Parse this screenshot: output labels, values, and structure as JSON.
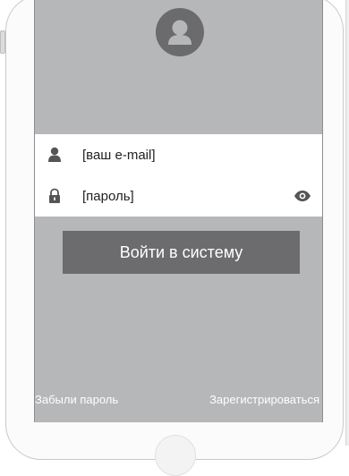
{
  "avatar": {
    "icon": "user-avatar-icon"
  },
  "form": {
    "email": {
      "placeholder": "[ваш e-mail]",
      "icon": "user-icon"
    },
    "password": {
      "placeholder": "[пароль]",
      "icon": "lock-icon",
      "toggle_icon": "eye-icon"
    }
  },
  "actions": {
    "login_label": "Войти в систему",
    "forgot_label": "Забыли пароль",
    "register_label": "Зарегистрироваться"
  },
  "colors": {
    "screen_bg": "#b6b7b9",
    "button_bg": "#6c6c6e",
    "avatar_bg": "#6b6b6d",
    "icon": "#555555"
  }
}
